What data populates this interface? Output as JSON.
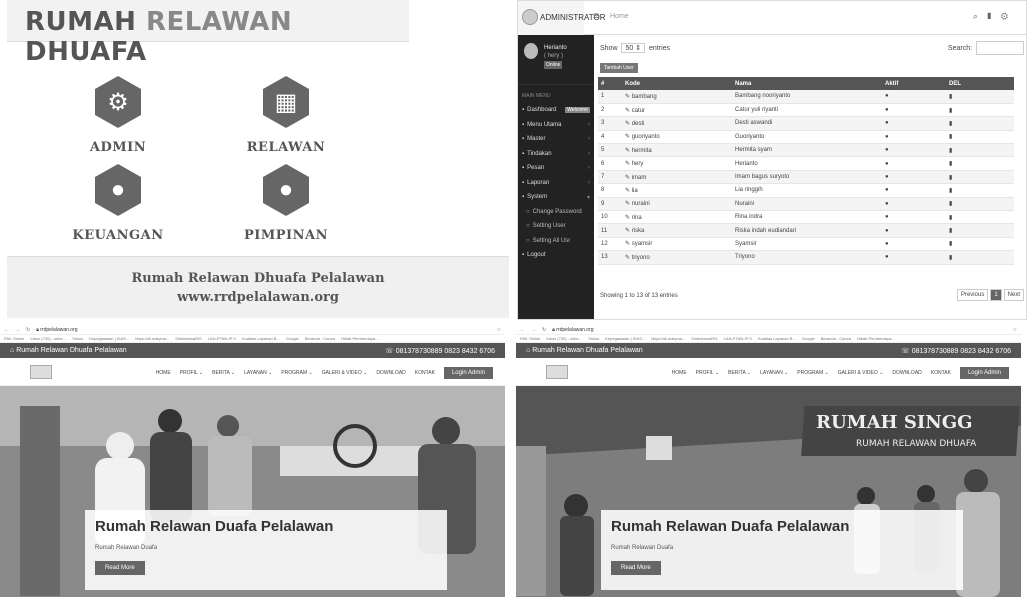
{
  "panel_menu": {
    "title_a": "RUMAH",
    "title_b": "RELAWAN",
    "title_c": "DHUAFA",
    "tiles": [
      {
        "label": "ADMIN",
        "icon": "gears-icon"
      },
      {
        "label": "RELAWAN",
        "icon": "presentation-icon"
      },
      {
        "label": "KEUANGAN",
        "icon": "user-icon"
      },
      {
        "label": "PIMPINAN",
        "icon": "user-icon"
      }
    ],
    "footer_line1": "Rumah Relawan Dhuafa Pelalawan",
    "footer_line2": "www.rrdpelalawan.org"
  },
  "admin": {
    "logo_text": "ADMINISTRATOR",
    "top_title": "Home",
    "user": {
      "name": "Herianto",
      "sub": "( hery )",
      "status": "Online"
    },
    "nav_header": "MAIN MENU",
    "nav": [
      {
        "label": "Dashboard",
        "badge": "Welcome",
        "sub": false
      },
      {
        "label": "Menu Utama",
        "chev": "‹",
        "sub": false
      },
      {
        "label": "Master",
        "chev": "‹",
        "sub": false
      },
      {
        "label": "Tindakan",
        "chev": "‹",
        "sub": false
      },
      {
        "label": "Pesan",
        "chev": "‹",
        "sub": false
      },
      {
        "label": "Laporan",
        "chev": "‹",
        "sub": false
      },
      {
        "label": "System",
        "chev": "▾",
        "sub": false
      },
      {
        "label": "Change Password",
        "sub": true
      },
      {
        "label": "Setting User",
        "sub": true
      },
      {
        "label": "Setting All Usr",
        "sub": true
      },
      {
        "label": "Logout",
        "sub": false
      }
    ],
    "show_label": "Show",
    "show_value": "50",
    "entries_label": "entries",
    "search_label": "Search:",
    "add_button": "Tambah User",
    "columns": [
      "#",
      "Kode",
      "Nama",
      "Aktif",
      "DEL"
    ],
    "rows": [
      {
        "no": "1",
        "kode": "bambang",
        "nama": "Bambang nooriyanto"
      },
      {
        "no": "2",
        "kode": "catur",
        "nama": "Catur yuli riyanti"
      },
      {
        "no": "3",
        "kode": "desti",
        "nama": "Desti aswandi"
      },
      {
        "no": "4",
        "kode": "guoriyanto",
        "nama": "Guoriyanto"
      },
      {
        "no": "5",
        "kode": "hermita",
        "nama": "Hermita syam"
      },
      {
        "no": "6",
        "kode": "hery",
        "nama": "Herianto"
      },
      {
        "no": "7",
        "kode": "imam",
        "nama": "Imam bagus suryoto"
      },
      {
        "no": "8",
        "kode": "lia",
        "nama": "Lia ringgih"
      },
      {
        "no": "9",
        "kode": "nuraini",
        "nama": "Nuraini"
      },
      {
        "no": "10",
        "kode": "rina",
        "nama": "Rina indra"
      },
      {
        "no": "11",
        "kode": "riska",
        "nama": "Riska indah eudiandari"
      },
      {
        "no": "12",
        "kode": "syamsir",
        "nama": "Syamsir"
      },
      {
        "no": "13",
        "kode": "triyono",
        "nama": "Triyono"
      }
    ],
    "footer_info": "Showing 1 to 13 of 13 entries",
    "prev": "Previous",
    "page": "1",
    "next": "Next"
  },
  "site": {
    "url": "rrdpelalawan.org",
    "bookmarks": [
      "PAK Online",
      "Inbox (730) - seke...",
      "Yahoo",
      "Kepegawaian | SIAS...",
      "https://dt-malyma...",
      "SimbelamaRiS",
      "LAN-PTAN-IP S",
      "Kualitas Layanan B...",
      "Google",
      "Beranda - Canva",
      "Hibah Pemberdaya..."
    ],
    "brand": "Rumah Relawan Dhuafa Pelalawan",
    "phone": "081378730889 0823 8432 6706",
    "menu": [
      "HOME",
      "PROFIL ⌄",
      "BERITA ⌄",
      "LAYANAN ⌄",
      "PROGRAM ⌄",
      "GALERI & VIDEO ⌄",
      "DOWNLOAD",
      "KONTAK"
    ],
    "login": "Login Admin",
    "hero_title": "Rumah Relawan Duafa Pelalawan",
    "hero_sub": "Rumah Relawan Duafa",
    "hero_btn": "Read More",
    "sign_text": "RUMAH RELAWAN DHUAFA",
    "sign_big": "RUMAH SINGG"
  }
}
